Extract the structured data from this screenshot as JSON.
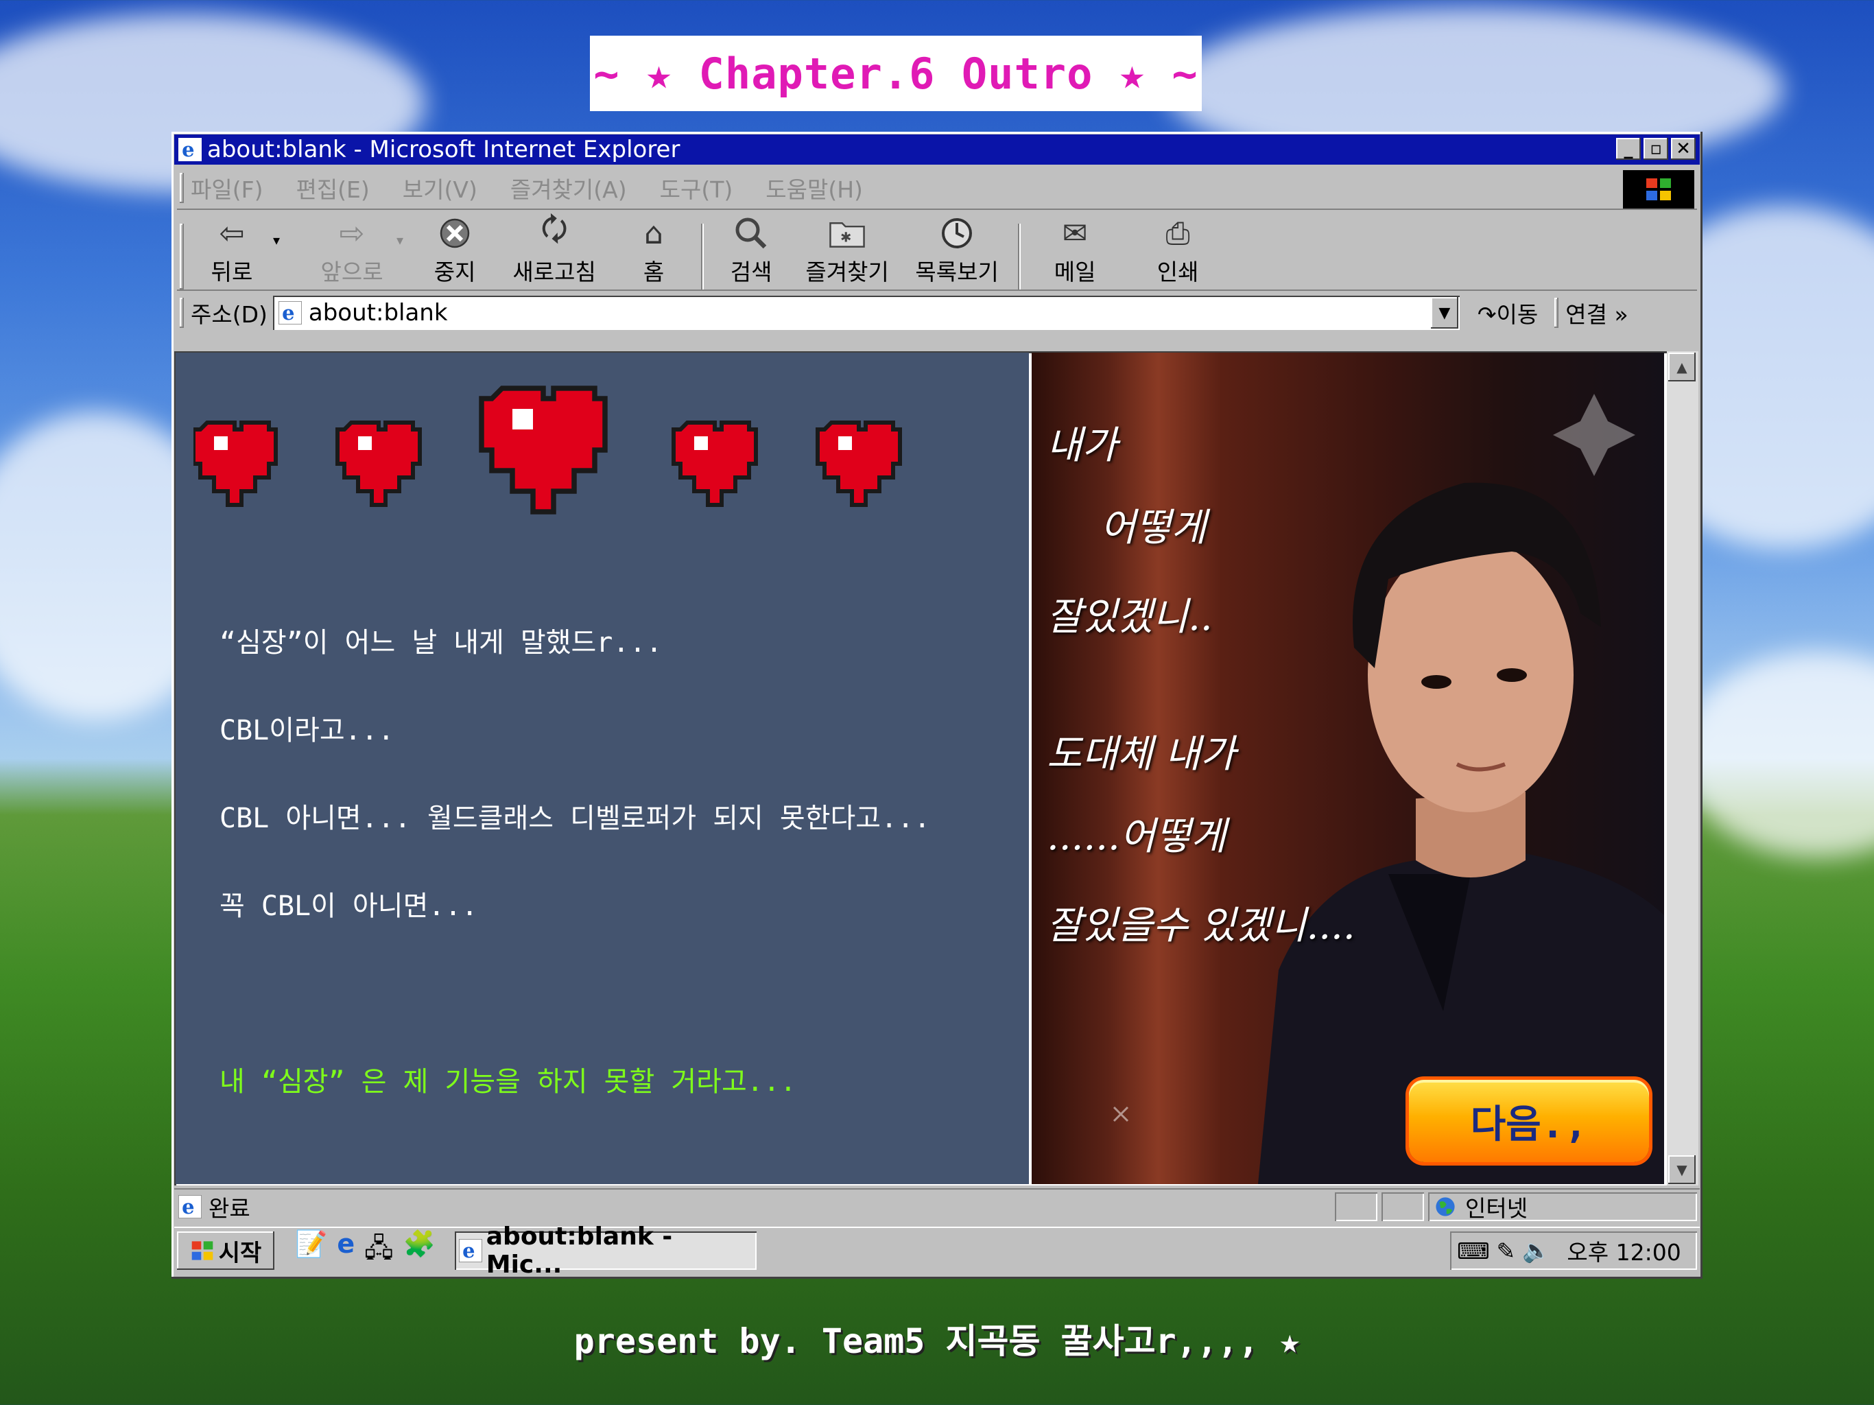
{
  "banner": {
    "title": "~ ★ Chapter.6 Outro ★ ~"
  },
  "window": {
    "title": "about:blank - Microsoft Internet Explorer",
    "controls": {
      "minimize": "_",
      "maximize": "▫",
      "close": "✕"
    },
    "menu": [
      "파일(F)",
      "편집(E)",
      "보기(V)",
      "즐겨찾기(A)",
      "도구(T)",
      "도움말(H)"
    ],
    "toolbar": {
      "back": "뒤로",
      "forward": "앞으로",
      "stop": "중지",
      "refresh": "새로고침",
      "home": "홈",
      "search": "검색",
      "favorites": "즐겨찾기",
      "history": "목록보기",
      "mail": "메일",
      "print": "인쇄"
    },
    "address": {
      "label": "주소(D)",
      "value": "about:blank",
      "go": "이동",
      "links": "연결 »"
    },
    "status": {
      "text": "완료",
      "zone": "인터넷"
    },
    "taskbar": {
      "start": "시작",
      "task": "about:blank - Mic...",
      "clock": "오후 12:00"
    }
  },
  "story": {
    "line1": "“심장”이 어느 날 내게 말했드r...",
    "line2": "CBL이라고...",
    "line3": "CBL 아니면... 월드클래스 디벨로퍼가 되지 못한다고...",
    "line4": "꼭 CBL이 아니면...",
    "line5": "내 “심장” 은 제 기능을 하지 못할 거라고..."
  },
  "photo": {
    "poem": [
      "내가",
      "어떻게",
      "잘있겠니..",
      "도대체 내가",
      "......어떻게",
      "잘있을수 있겠니...."
    ],
    "next_button": "다음.,"
  },
  "footer": {
    "credit": "present by. Team5 지곡동 꿀사고r,,,, ★"
  },
  "colors": {
    "titlebar": "#0a14a8",
    "panel": "#44546f",
    "highlight": "#7fff1a",
    "banner_text": "#e01ab5"
  }
}
